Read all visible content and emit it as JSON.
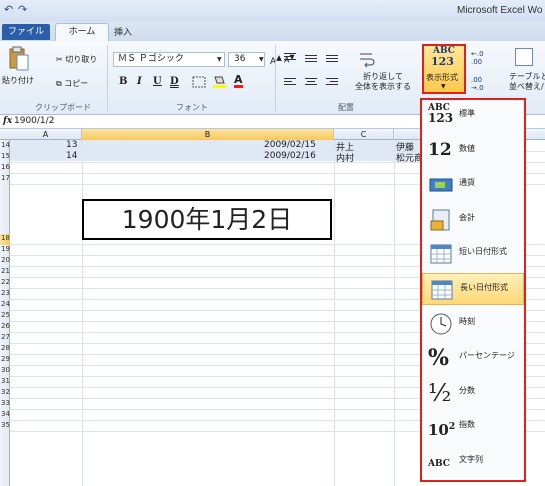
{
  "app": {
    "title": "Microsoft Excel Wo"
  },
  "tabs": {
    "file": "ファイル",
    "home": "ホーム",
    "insert": "挿入"
  },
  "ribbon": {
    "clipboard": {
      "paste": "貼り付け",
      "cut": "切り取り",
      "copy": "コピー",
      "group": "クリップボード"
    },
    "font": {
      "name": "ＭＳ Ｐゴシック",
      "size": "36",
      "group": "フォント",
      "bold": "B",
      "italic": "I",
      "underline": "U",
      "double_underline": "D"
    },
    "alignment": {
      "wrap": [
        "折り返して",
        "全体を表示する"
      ],
      "group": "配置"
    },
    "number": {
      "abc": "ABC",
      "digits": "123",
      "label": "表示形式"
    },
    "table": {
      "label": [
        "テーブルと",
        "並べ替え/フ"
      ]
    }
  },
  "formula_bar": {
    "fx": "fx",
    "value": "1900/1/2"
  },
  "columns": [
    "A",
    "B",
    "C"
  ],
  "rows": [
    "14",
    "15",
    "16",
    "17",
    "18",
    "19",
    "20",
    "21",
    "22",
    "23",
    "24",
    "25",
    "26",
    "27",
    "28",
    "29",
    "30",
    "31",
    "32",
    "33",
    "34",
    "35"
  ],
  "cells": {
    "a14": "13",
    "b14": "2009/02/15",
    "c14": "井上",
    "d14": "伊藤",
    "a15": "14",
    "b15": "2009/02/16",
    "c15": "内村",
    "d15": "松元商",
    "b18": "1900年1月2日"
  },
  "number_format_menu": [
    {
      "label": "標準",
      "icon": "general-format-icon"
    },
    {
      "label": "数値",
      "icon": "number-format-icon"
    },
    {
      "label": "通貨",
      "icon": "currency-format-icon"
    },
    {
      "label": "会計",
      "icon": "accounting-format-icon"
    },
    {
      "label": "短い日付形式",
      "icon": "short-date-icon"
    },
    {
      "label": "長い日付形式",
      "icon": "long-date-icon",
      "selected": true
    },
    {
      "label": "時刻",
      "icon": "clock-icon"
    },
    {
      "label": "パーセンテージ",
      "icon": "percent-icon"
    },
    {
      "label": "分数",
      "icon": "fraction-icon"
    },
    {
      "label": "指数",
      "icon": "scientific-icon"
    },
    {
      "label": "文字列",
      "icon": "text-format-icon"
    }
  ],
  "menu_icon_text": {
    "general": "ABC",
    "general_digits": "123",
    "number": "12",
    "percent": "%",
    "fraction": "½",
    "scientific": "10",
    "scientific_exp": "2",
    "text": "ABC"
  },
  "colors": {
    "accent": "#2a5ea8",
    "highlight": "#e0201a",
    "selected": "#ffd877"
  }
}
